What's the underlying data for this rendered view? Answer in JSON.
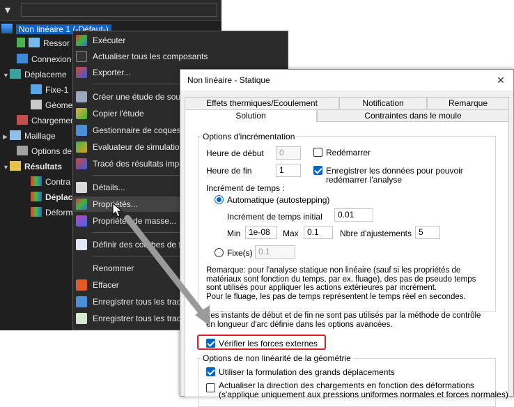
{
  "tree": {
    "root_label": "Non linéaire 1 (-Défaut-)",
    "nodes": [
      {
        "label": "Ressor"
      },
      {
        "label": "Connexion"
      },
      {
        "label": "Déplaceme"
      },
      {
        "label": "Fixe-1"
      },
      {
        "label": "Géome"
      },
      {
        "label": "Chargemen"
      },
      {
        "label": "Maillage"
      },
      {
        "label": "Options de"
      },
      {
        "label": "Résultats"
      },
      {
        "label": "Contra"
      },
      {
        "label": "Déplac"
      },
      {
        "label": "Déform"
      }
    ]
  },
  "context_menu": {
    "items": [
      {
        "label": "Exécuter"
      },
      {
        "label": "Actualiser tous les composants"
      },
      {
        "label": "Exporter..."
      },
      {
        "label": "Créer une étude de sous"
      },
      {
        "label": "Copier l'étude"
      },
      {
        "label": "Gestionnaire de coques"
      },
      {
        "label": "Evaluateur de simulation"
      },
      {
        "label": "Tracé des résultats impo"
      },
      {
        "label": "Détails..."
      },
      {
        "label": "Propriétés..."
      },
      {
        "label": "Propriétés de masse..."
      },
      {
        "label": "Définir des courbes de f"
      },
      {
        "label": "Renommer"
      },
      {
        "label": "Effacer"
      },
      {
        "label": "Enregistrer tous les tracé"
      },
      {
        "label": "Enregistrer tous les tracé"
      }
    ]
  },
  "dialog": {
    "title": "Non linéaire - Statique",
    "close_glyph": "✕",
    "tabs": {
      "effets": "Effets thermiques/Ecoulement",
      "notification": "Notification",
      "remarque": "Remarque",
      "solution": "Solution",
      "contraintes": "Contraintes dans le moule"
    },
    "incr": {
      "legend": "Options d'incrémentation",
      "heure_debut_label": "Heure de début",
      "heure_debut_value": "0",
      "redemarrer_label": "Redémarrer",
      "heure_fin_label": "Heure de fin",
      "heure_fin_value": "1",
      "enregistrer_label_1": "Enregistrer les données pour pouvoir",
      "enregistrer_label_2": "redémarrer l'analyse",
      "increment_label": "Incrément de temps :",
      "auto_label": "Automatique (autostepping)",
      "initial_label": "Incrément de temps initial",
      "initial_value": "0.01",
      "min_label": "Min",
      "min_value": "1e-08",
      "max_label": "Max",
      "max_value": "0.1",
      "nbre_label": "Nbre d'ajustements",
      "nbre_value": "5",
      "fixe_label": "Fixe(s)",
      "fixe_value": "0.1"
    },
    "note_lines": [
      "Remarque: pour l'analyse statique non linéaire (sauf si les propriétés de",
      "matériaux sont fonction du temps, par ex. fluage), des pas de pseudo temps",
      "sont utilisés pour appliquer les actions extérieures par incrément.",
      "Pour le fluage, les pas de temps représentent le temps réel en secondes."
    ],
    "note2_lines": [
      "Les instants de début et de fin ne sont pas utilisés par la méthode de contrôle",
      "en longueur d'arc définie dans les options avancées."
    ],
    "verifier_label": "Vérifier les forces externes",
    "geo": {
      "legend": "Options de non linéarité de la géométrie",
      "grands_depl_label": "Utiliser la formulation des grands déplacements",
      "actualiser_label_1": "Actualiser la direction des chargements en fonction des déformations",
      "actualiser_label_2": "(s'applique uniquement aux pressions uniformes normales et forces normales)"
    }
  },
  "colors": {
    "selection": "#0e63c2",
    "menu_bg": "#2b2b2b",
    "highlight_box": "#d6202a",
    "checkbox_on": "#0067c0"
  }
}
